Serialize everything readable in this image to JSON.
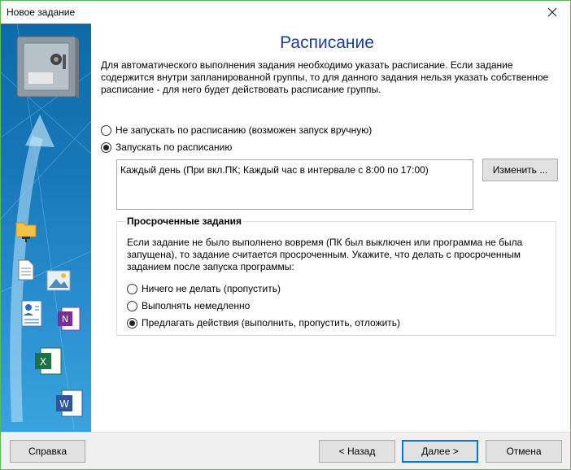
{
  "window": {
    "title": "Новое задание"
  },
  "page": {
    "heading": "Расписание",
    "description": "Для автоматического выполнения задания необходимо указать расписание. Если задание содержится внутри запланированной группы, то для данного задания нельзя указать собственное расписание - для него будет действовать расписание группы."
  },
  "schedule": {
    "options": [
      {
        "label": "Не запускать по расписанию (возможен запуск вручную)",
        "checked": false
      },
      {
        "label": "Запускать по расписанию",
        "checked": true
      }
    ],
    "summary": "Каждый день (При вкл.ПК; Каждый час в интервале с  8:00 по 17:00)",
    "change_label": "Изменить ..."
  },
  "overdue": {
    "title": "Просроченные задания",
    "text": "Если задание не было выполнено вовремя (ПК был выключен или программа не была запущена), то задание считается просроченным. Укажите, что делать с просроченным заданием после запуска программы:",
    "options": [
      {
        "label": "Ничего не делать (пропустить)",
        "checked": false
      },
      {
        "label": "Выполнять немедленно",
        "checked": false
      },
      {
        "label": "Предлагать действия (выполнить, пропустить, отложить)",
        "checked": true
      }
    ]
  },
  "footer": {
    "help": "Справка",
    "back": "< Назад",
    "next": "Далее >",
    "cancel": "Отмена"
  },
  "colors": {
    "heading": "#1d3e94",
    "sidebar": "#1677b8",
    "window_border": "#5cb85c",
    "focus": "#0078d7"
  },
  "icons": [
    "safe-icon",
    "folder-icon",
    "document-icon",
    "image-icon",
    "contacts-icon",
    "onenote-icon",
    "excel-icon",
    "word-icon",
    "close-icon"
  ]
}
